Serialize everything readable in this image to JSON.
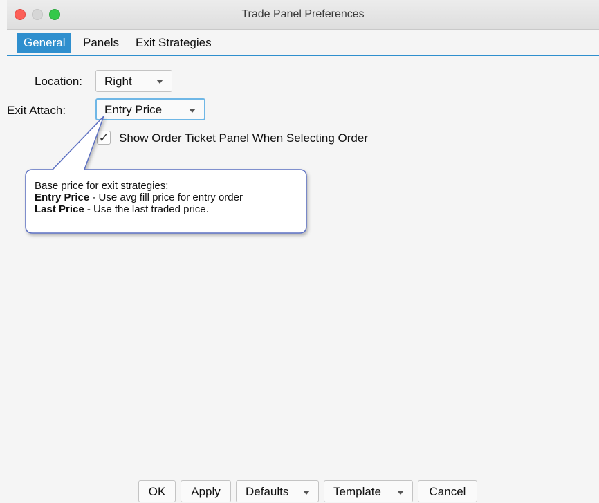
{
  "window": {
    "title": "Trade Panel Preferences"
  },
  "tabs": [
    {
      "label": "General",
      "active": true
    },
    {
      "label": "Panels",
      "active": false
    },
    {
      "label": "Exit Strategies",
      "active": false
    }
  ],
  "form": {
    "location": {
      "label": "Location:",
      "value": "Right"
    },
    "exit_attach": {
      "label": "Exit Attach:",
      "value": "Entry Price"
    },
    "show_ticket": {
      "label": "Show Order Ticket Panel When Selecting Order",
      "checked": true,
      "mark": "✓"
    }
  },
  "tooltip": {
    "line1": "Base price for exit strategies:",
    "line2_bold": "Entry Price",
    "line2_rest": " - Use avg fill price for entry order",
    "line3_bold": "Last Price",
    "line3_rest": " - Use the last traded price."
  },
  "buttons": {
    "ok": "OK",
    "apply": "Apply",
    "defaults": "Defaults",
    "template": "Template",
    "cancel": "Cancel"
  },
  "colors": {
    "accent": "#2f8fce",
    "close": "#fc5f57",
    "maximize": "#34c84a"
  }
}
